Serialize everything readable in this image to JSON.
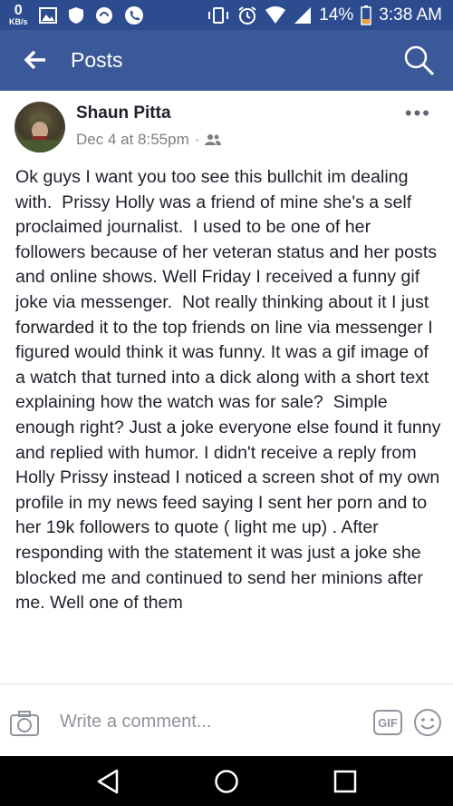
{
  "status_bar": {
    "speed_value": "0",
    "speed_unit": "KB/s",
    "battery": "14%",
    "time": "3:38 AM"
  },
  "app_bar": {
    "title": "Posts"
  },
  "post": {
    "author": "Shaun Pitta",
    "timestamp": "Dec 4 at 8:55pm",
    "separator": "·",
    "text": "Ok guys I want you too see this bullchit im dealing with.  Prissy Holly was a friend of mine she's a self proclaimed journalist.  I used to be one of her followers because of her veteran status and her posts and online shows. Well Friday I received a funny gif joke via messenger.  Not really thinking about it I just forwarded it to the top friends on line via messenger I figured would think it was funny. It was a gif image of a watch that turned into a dick along with a short text explaining how the watch was for sale?  Simple enough right? Just a joke everyone else found it funny and replied with humor. I didn't receive a reply from Holly Prissy instead I noticed a screen shot of my own profile in my news feed saying I sent her porn and to her 19k followers to quote ( light me up) . After responding with the statement it was just a joke she blocked me and continued to send her minions after me. Well one of them"
  },
  "comment_bar": {
    "placeholder": "Write a comment...",
    "gif_label": "GIF"
  },
  "colors": {
    "status_bar_bg": "#2d4b8f",
    "app_bar_bg": "#3b5998",
    "text": "#1d2129",
    "meta": "#7f7f7f"
  },
  "icons": [
    "notification-icons",
    "vibrate-icon",
    "alarm-icon",
    "wifi-icon",
    "signal-icon",
    "battery-icon",
    "back-arrow-icon",
    "search-icon",
    "more-options-icon",
    "friends-audience-icon",
    "camera-icon",
    "gif-icon",
    "emoji-icon",
    "nav-back-icon",
    "nav-home-icon",
    "nav-recents-icon"
  ]
}
